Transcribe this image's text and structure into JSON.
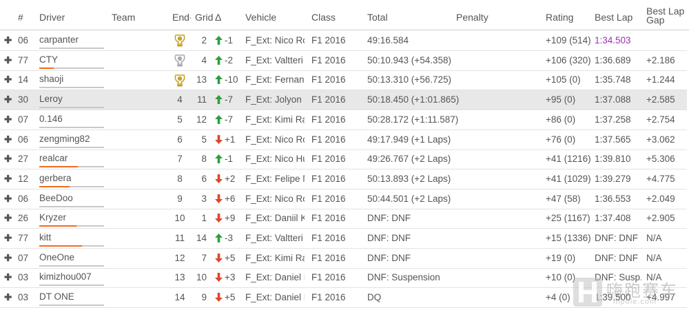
{
  "header": {
    "num": "#",
    "driver": "Driver",
    "team": "Team",
    "end": "End",
    "grid": "Grid",
    "delta": "Δ",
    "vehicle": "Vehicle",
    "class": "Class",
    "total": "Total",
    "penalty": "Penalty",
    "rating": "Rating",
    "best_lap": "Best Lap",
    "best_lap_gap": "Best Lap Gap"
  },
  "colors": {
    "up": "#2e9e3e",
    "down": "#e0452b",
    "accent": "#f26b1d",
    "fastest": "#9b2fb0",
    "gold": "#c9a227",
    "silver": "#a9a9b2"
  },
  "rows": [
    {
      "num": "06",
      "driver": "carpanter",
      "bar": 0.0,
      "end": "",
      "trophy": "gold-trophy-icon",
      "grid": "2",
      "dir": "up",
      "delta": "-1",
      "vehicle": "F_Ext: Nico Ros...",
      "class": "F1 2016",
      "total": "49:16.584",
      "rating": "+109 (514)",
      "best": "1:34.503",
      "fastest": true,
      "gap": ""
    },
    {
      "num": "77",
      "driver": "CTY",
      "bar": 0.22,
      "end": "",
      "trophy": "silver-trophy-icon",
      "grid": "4",
      "dir": "up",
      "delta": "-2",
      "vehicle": "F_Ext: Valtteri B...",
      "class": "F1 2016",
      "total": "50:10.943 (+54.358)",
      "rating": "+106 (320)",
      "best": "1:36.689",
      "gap": "+2.186"
    },
    {
      "num": "14",
      "driver": "shaoji",
      "bar": 0.0,
      "end": "",
      "trophy": "gold-trophy-icon",
      "grid": "13",
      "dir": "up",
      "delta": "-10",
      "vehicle": "F_Ext: Fernand...",
      "class": "F1 2016",
      "total": "50:13.310 (+56.725)",
      "rating": "+105 (0)",
      "best": "1:35.748",
      "gap": "+1.244"
    },
    {
      "num": "30",
      "driver": "Leroy",
      "bar": 0.0,
      "end": "4",
      "grid": "11",
      "dir": "up",
      "delta": "-7",
      "vehicle": "F_Ext: Jolyon P...",
      "class": "F1 2016",
      "total": "50:18.450 (+1:01.865)",
      "rating": "+95 (0)",
      "best": "1:37.088",
      "gap": "+2.585",
      "highlight": true
    },
    {
      "num": "07",
      "driver": "0.146",
      "bar": 0.0,
      "end": "5",
      "grid": "12",
      "dir": "up",
      "delta": "-7",
      "vehicle": "F_Ext: Kimi Rai...",
      "class": "F1 2016",
      "total": "50:28.172 (+1:11.587)",
      "rating": "+86 (0)",
      "best": "1:37.258",
      "gap": "+2.754"
    },
    {
      "num": "06",
      "driver": "zengming82",
      "bar": 0.0,
      "end": "6",
      "grid": "5",
      "dir": "down",
      "delta": "+1",
      "vehicle": "F_Ext: Nico Ros...",
      "class": "F1 2016",
      "total": "49:17.949 (+1 Laps)",
      "rating": "+76 (0)",
      "best": "1:37.565",
      "gap": "+3.062"
    },
    {
      "num": "27",
      "driver": "realcar",
      "bar": 0.6,
      "end": "7",
      "grid": "8",
      "dir": "up",
      "delta": "-1",
      "vehicle": "F_Ext: Nico Hul...",
      "class": "F1 2016",
      "total": "49:26.767 (+2 Laps)",
      "rating": "+41 (1216)",
      "best": "1:39.810",
      "gap": "+5.306"
    },
    {
      "num": "12",
      "driver": "gerbera",
      "bar": 0.47,
      "end": "8",
      "grid": "6",
      "dir": "down",
      "delta": "+2",
      "vehicle": "F_Ext: Felipe N...",
      "class": "F1 2016",
      "total": "50:13.893 (+2 Laps)",
      "rating": "+41 (1029)",
      "best": "1:39.279",
      "gap": "+4.775"
    },
    {
      "num": "06",
      "driver": "BeeDoo",
      "bar": 0.0,
      "end": "9",
      "grid": "3",
      "dir": "down",
      "delta": "+6",
      "vehicle": "F_Ext: Nico Ros...",
      "class": "F1 2016",
      "total": "50:44.501 (+2 Laps)",
      "rating": "+47 (58)",
      "best": "1:36.553",
      "gap": "+2.049"
    },
    {
      "num": "26",
      "driver": "Kryzer",
      "bar": 0.57,
      "end": "10",
      "grid": "1",
      "dir": "down",
      "delta": "+9",
      "vehicle": "F_Ext: Daniil Kv...",
      "class": "F1 2016",
      "total": "DNF: DNF",
      "rating": "+25 (1167)",
      "best": "1:37.408",
      "gap": "+2.905"
    },
    {
      "num": "77",
      "driver": "kitt",
      "bar": 0.66,
      "end": "11",
      "grid": "14",
      "dir": "up",
      "delta": "-3",
      "vehicle": "F_Ext: Valtteri B...",
      "class": "F1 2016",
      "total": "DNF: DNF",
      "rating": "+15 (1336)",
      "best": "DNF: DNF",
      "gap": "N/A"
    },
    {
      "num": "07",
      "driver": "OneOne",
      "bar": 0.0,
      "end": "12",
      "grid": "7",
      "dir": "down",
      "delta": "+5",
      "vehicle": "F_Ext: Kimi Rai...",
      "class": "F1 2016",
      "total": "DNF: DNF",
      "rating": "+19 (0)",
      "best": "DNF: DNF",
      "gap": "N/A"
    },
    {
      "num": "03",
      "driver": "kimizhou007",
      "bar": 0.0,
      "end": "13",
      "grid": "10",
      "dir": "down",
      "delta": "+3",
      "vehicle": "F_Ext: Daniel R...",
      "class": "F1 2016",
      "total": "DNF: Suspension",
      "rating": "+10 (0)",
      "best": "DNF: Susp...",
      "gap": "N/A"
    },
    {
      "num": "03",
      "driver": "DT ONE",
      "bar": 0.0,
      "end": "14",
      "grid": "9",
      "dir": "down",
      "delta": "+5",
      "vehicle": "F_Ext: Daniel R...",
      "class": "F1 2016",
      "total": "DQ",
      "rating": "+4 (0)",
      "best": "1:39.500",
      "gap": "+4.997"
    }
  ],
  "watermark": {
    "logo": "嗨跑赛车",
    "sub": "hipole.com"
  }
}
